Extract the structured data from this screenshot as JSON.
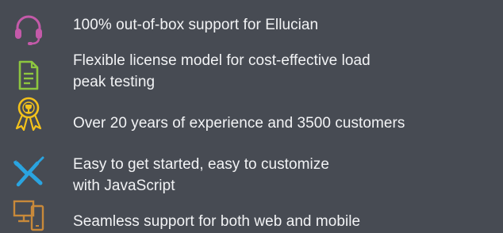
{
  "features": [
    {
      "icon": "headset-icon",
      "icon_color": "#c45aa9",
      "lines": [
        "100% out-of-box support for Ellucian"
      ]
    },
    {
      "icon": "document-icon",
      "icon_color": "#8dc63f",
      "lines": [
        "Flexible license model for cost-effective load",
        "peak testing"
      ]
    },
    {
      "icon": "award-ribbon-icon",
      "icon_color": "#f3c21b",
      "lines": [
        "Over 20 years of experience and 3500 customers"
      ]
    },
    {
      "icon": "wrench-screwdriver-icon",
      "icon_color": "#2aa4e0",
      "lines": [
        "Easy to get started, easy to customize",
        "with JavaScript"
      ]
    },
    {
      "icon": "devices-icon",
      "icon_color": "#c8893a",
      "lines": [
        "Seamless support for both web and mobile"
      ]
    }
  ]
}
